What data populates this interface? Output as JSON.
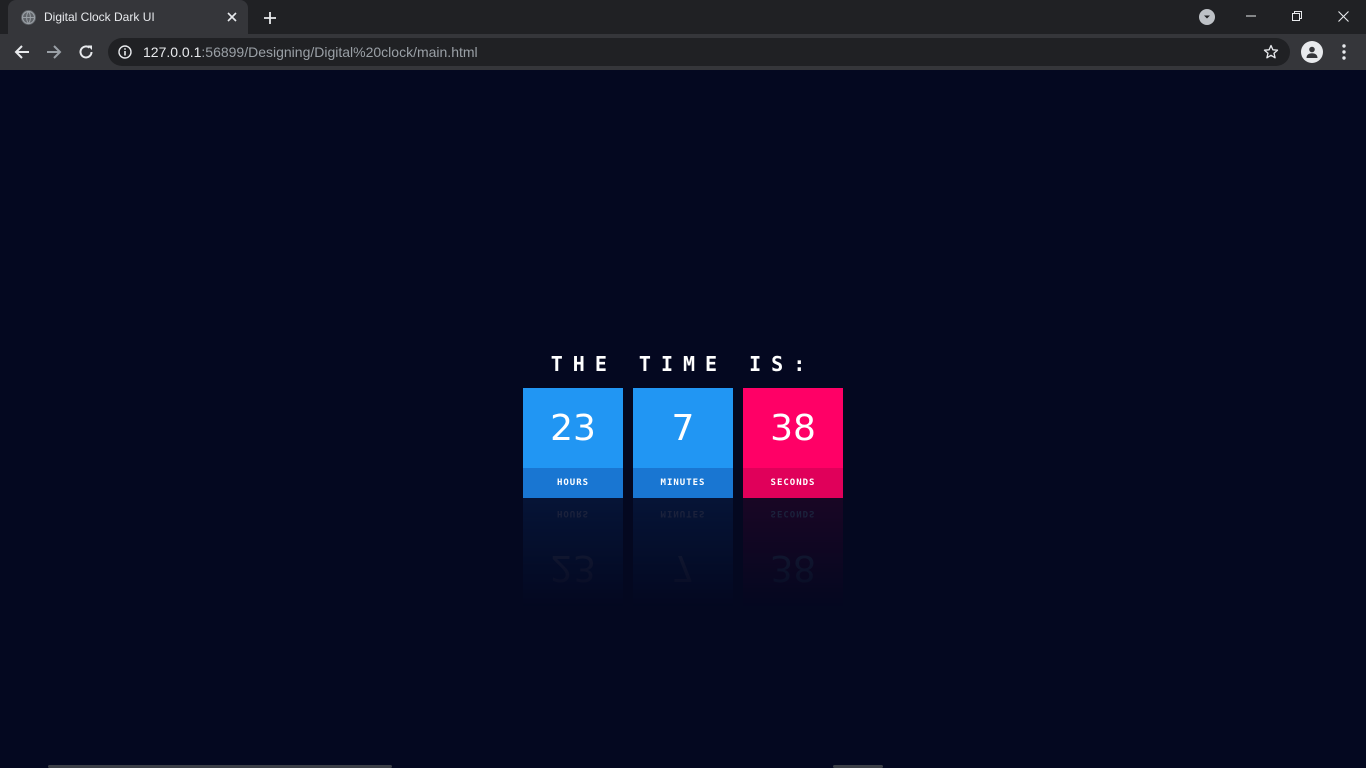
{
  "browser": {
    "tab_title": "Digital Clock Dark UI",
    "url_host": "127.0.0.1",
    "url_rest": ":56899/Designing/Digital%20clock/main.html"
  },
  "page": {
    "heading": "THE TIME IS:",
    "clock": [
      {
        "value": "23",
        "label": "HOURS",
        "color": "#2196f3"
      },
      {
        "value": "7",
        "label": "MINUTES",
        "color": "#2196f3"
      },
      {
        "value": "38",
        "label": "SECONDS",
        "color": "#ff0066"
      }
    ]
  },
  "colors": {
    "background": "#040820",
    "accent_blue": "#2196f3",
    "accent_pink": "#ff0066"
  }
}
